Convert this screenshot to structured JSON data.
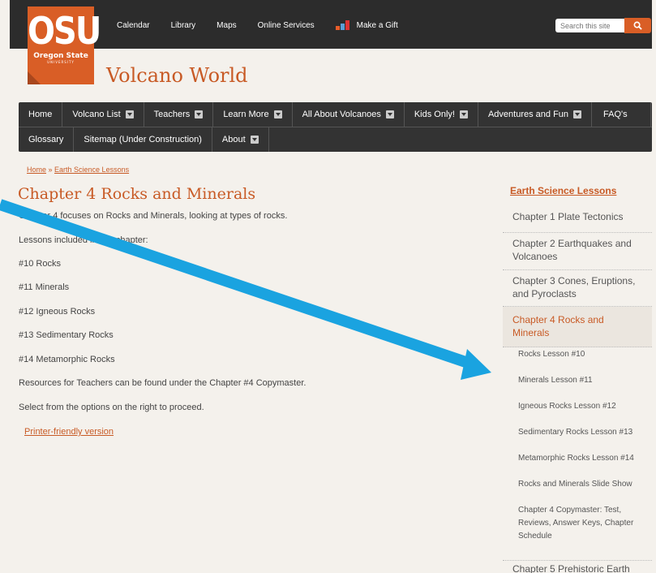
{
  "header": {
    "logo_text": "OSU",
    "logo_sub": "Oregon State",
    "logo_sub2": "UNIVERSITY",
    "utility_nav": [
      "Calendar",
      "Library",
      "Maps",
      "Online Services",
      "Make a Gift"
    ],
    "search_placeholder": "Search this site",
    "search_icon": "search-icon",
    "site_title": "Volcano World"
  },
  "nav": {
    "row1": [
      "Home",
      "Volcano List",
      "Teachers",
      "Learn More",
      "All About Volcanoes",
      "Kids Only!",
      "Adventures and Fun",
      "FAQ's"
    ],
    "row2": [
      "Glossary",
      "Sitemap (Under Construction)",
      "About"
    ]
  },
  "breadcrumb": {
    "home": "Home",
    "sep": " » ",
    "current": "Earth Science Lessons"
  },
  "main": {
    "title": "Chapter 4 Rocks and Minerals",
    "paragraphs": [
      "Chapter 4 focuses on Rocks and Minerals, looking at types of rocks.",
      "Lessons included in this chapter:",
      "#10 Rocks",
      "#11 Minerals",
      "#12 Igneous Rocks",
      "#13 Sedimentary Rocks",
      "#14 Metamorphic Rocks",
      "Resources for Teachers can be found under the Chapter #4 Copymaster.",
      "Select from the options on the right to proceed."
    ],
    "printer_link": "Printer-friendly version"
  },
  "sidebar": {
    "heading": "Earth Science Lessons",
    "chapters": [
      "Chapter 1 Plate Tectonics",
      "Chapter 2 Earthquakes and Volcanoes",
      "Chapter 3 Cones, Eruptions, and Pyroclasts",
      "Chapter 4 Rocks and Minerals",
      "Chapter 5 Prehistoric Earth"
    ],
    "subitems": [
      "Rocks Lesson #10",
      "Minerals Lesson #11",
      "Igneous Rocks Lesson #12",
      "Sedimentary Rocks Lesson #13",
      "Metamorphic Rocks Lesson #14",
      "Rocks and Minerals Slide Show",
      "Chapter 4 Copymaster: Test, Reviews, Answer Keys, Chapter Schedule"
    ]
  },
  "colors": {
    "accent": "#d95e26",
    "link": "#c85a25",
    "nav_bg": "#333333",
    "arrow": "#1aa3e0"
  }
}
